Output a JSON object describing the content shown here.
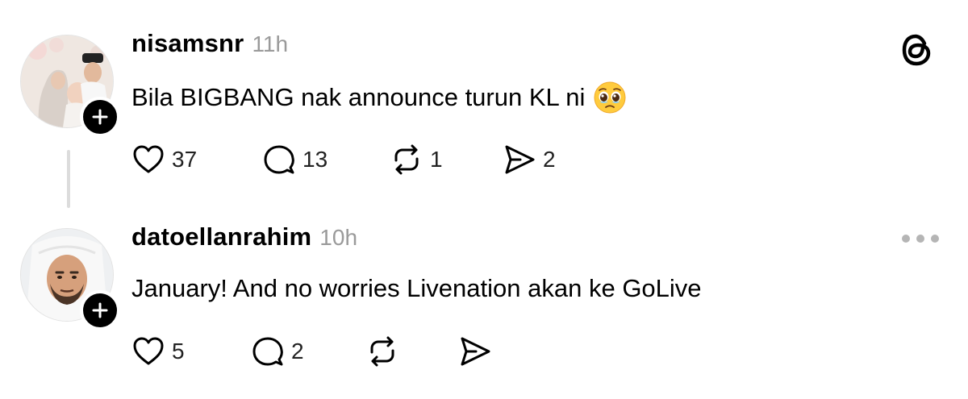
{
  "posts": [
    {
      "username": "nisamsnr",
      "time": "11h",
      "text": "Bila BIGBANG nak announce turun KL ni",
      "emoji": "pleading-face",
      "counts": {
        "likes": "37",
        "replies": "13",
        "reposts": "1",
        "shares": "2"
      }
    },
    {
      "username": "datoellanrahim",
      "time": "10h",
      "text": "January! And no worries Livenation akan ke GoLive",
      "counts": {
        "likes": "5",
        "replies": "2",
        "reposts": "",
        "shares": ""
      }
    }
  ],
  "icons": {
    "app_logo": "threads-logo-icon",
    "like": "heart-icon",
    "reply": "comment-icon",
    "repost": "repost-icon",
    "share": "send-icon",
    "more": "more-options-icon",
    "follow": "plus-icon"
  },
  "colors": {
    "text": "#000000",
    "muted": "#9a9a9a",
    "badge": "#000000",
    "thread_line": "#dcdcdc"
  }
}
